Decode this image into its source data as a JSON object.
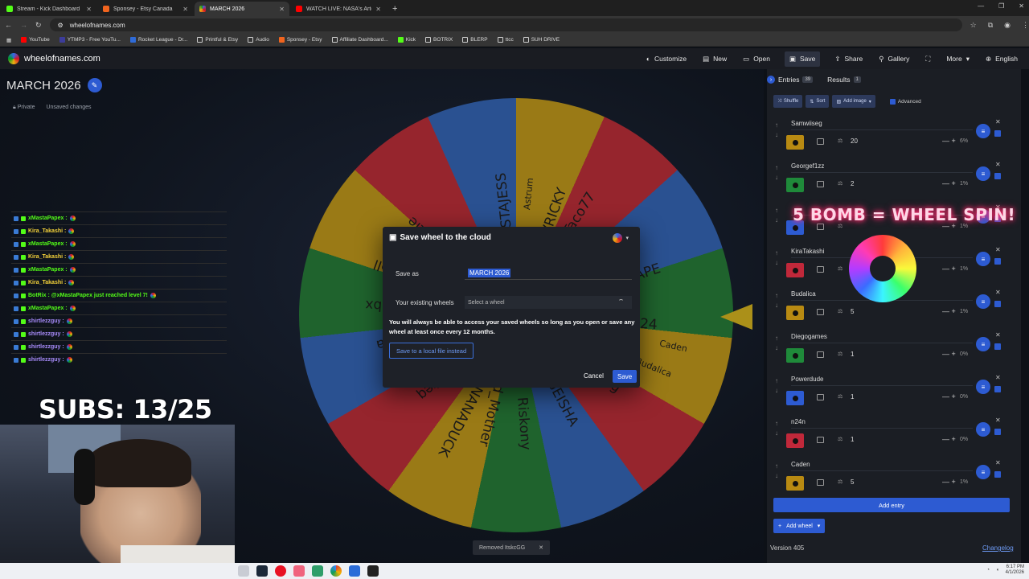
{
  "browser": {
    "tabs": [
      {
        "title": "Stream - Kick Dashboard",
        "color": "#53fc18",
        "active": false
      },
      {
        "title": "Sponsey - Etsy Canada",
        "color": "#f1641e",
        "active": false
      },
      {
        "title": "MARCH 2026",
        "color": "#3369e8",
        "active": true
      },
      {
        "title": "WATCH LIVE: NASA's Artem",
        "color": "#ff0000",
        "active": false
      }
    ],
    "url": "wheelofnames.com",
    "bookmarks": [
      "YouTube",
      "YTMP3 - Free YouTu...",
      "Rocket League - Dr...",
      "Printful & Etsy",
      "Audio",
      "Sponsey - Etsy",
      "Affiliate Dashboard...",
      "Kick",
      "BOTRIX",
      "BLERP",
      "ttcc",
      "SUH DRIVE"
    ]
  },
  "app": {
    "brand": "wheelofnames.com",
    "menu": [
      "Customize",
      "New",
      "Open",
      "Save",
      "Share",
      "Gallery",
      "",
      "More",
      "English"
    ],
    "wheel_title": "MARCH 2026",
    "privacy": "Private",
    "status": "Unsaved changes"
  },
  "chat": [
    {
      "user": "xMastaPapex :",
      "color": "#53fc18"
    },
    {
      "user": "Kira_Takashi :",
      "color": "#f5d33a"
    },
    {
      "user": "xMastaPapex :",
      "color": "#53fc18"
    },
    {
      "user": "Kira_Takashi :",
      "color": "#f5d33a"
    },
    {
      "user": "xMastaPapex :",
      "color": "#53fc18"
    },
    {
      "user": "Kira_Takashi :",
      "color": "#f5d33a"
    },
    {
      "user": "BotRix : @xMastaPapex just reached level 7!",
      "color": "#53fc18"
    },
    {
      "user": "xMastaPapex :",
      "color": "#53fc18"
    },
    {
      "user": "shirtlezzguy :",
      "color": "#a78bfa"
    },
    {
      "user": "shirtlezzguy :",
      "color": "#a78bfa"
    },
    {
      "user": "shirtlezzguy :",
      "color": "#a78bfa"
    },
    {
      "user": "shirtlezzguy :",
      "color": "#a78bfa"
    }
  ],
  "subs_label": "SUBS: 13/25",
  "wheel_labels": [
    "MASTAJESS",
    "Astrum",
    "GOTTALUVRICKY",
    "PockerTaco77",
    "STAPAPE",
    "Caden",
    "man_kayla2024",
    "Budalica",
    "Samwiiseg",
    "VELVETGEISHA",
    "Riskony",
    "Mod_Mother",
    "BANANANANADUCK",
    "Cixteq",
    "Miranda",
    "FallendragonI7bx",
    "Onebrainceell",
    "stle"
  ],
  "dialog": {
    "title": "Save wheel to the cloud",
    "save_as_label": "Save as",
    "save_as_value": "MARCH 2026",
    "existing_label": "Your existing wheels",
    "existing_placeholder": "Select a wheel",
    "note": "You will always be able to access your saved wheels so long as you open or save any wheel at least once every 12 months.",
    "local_button": "Save to a local file instead",
    "cancel": "Cancel",
    "save": "Save"
  },
  "toast": "Removed ItskcGG",
  "panel": {
    "tab_entries": "Entries",
    "entries_count": "39",
    "tab_results": "Results",
    "results_count": "1",
    "toolbar": [
      "Shuffle",
      "Sort",
      "Add image"
    ],
    "advanced": "Advanced",
    "entries": [
      {
        "name": "Samwiiseg",
        "weight": "20",
        "pct": "6%",
        "color": "#b88a12"
      },
      {
        "name": "Georgef1zz",
        "weight": "2",
        "pct": "1%",
        "color": "#1f8a3a"
      },
      {
        "name": "",
        "weight": "",
        "pct": "1%",
        "color": "#2d5bd2"
      },
      {
        "name": "KiraTakashi",
        "weight": "",
        "pct": "1%",
        "color": "#c0283a"
      },
      {
        "name": "Budalica",
        "weight": "5",
        "pct": "1%",
        "color": "#b88a12"
      },
      {
        "name": "Diegogames",
        "weight": "1",
        "pct": "0%",
        "color": "#1f8a3a"
      },
      {
        "name": "Powerdude",
        "weight": "1",
        "pct": "0%",
        "color": "#2d5bd2"
      },
      {
        "name": "n24n",
        "weight": "1",
        "pct": "0%",
        "color": "#c0283a"
      },
      {
        "name": "Caden",
        "weight": "5",
        "pct": "1%",
        "color": "#b88a12"
      }
    ],
    "add_entry": "Add entry",
    "add_wheel": "Add wheel",
    "version": "Version 405",
    "changelog": "Changelog"
  },
  "overlay_text": "5 BOMB = WHEEL SPIN!",
  "taskbar": {
    "time": "6:17 PM",
    "date": "4/1/2026"
  }
}
